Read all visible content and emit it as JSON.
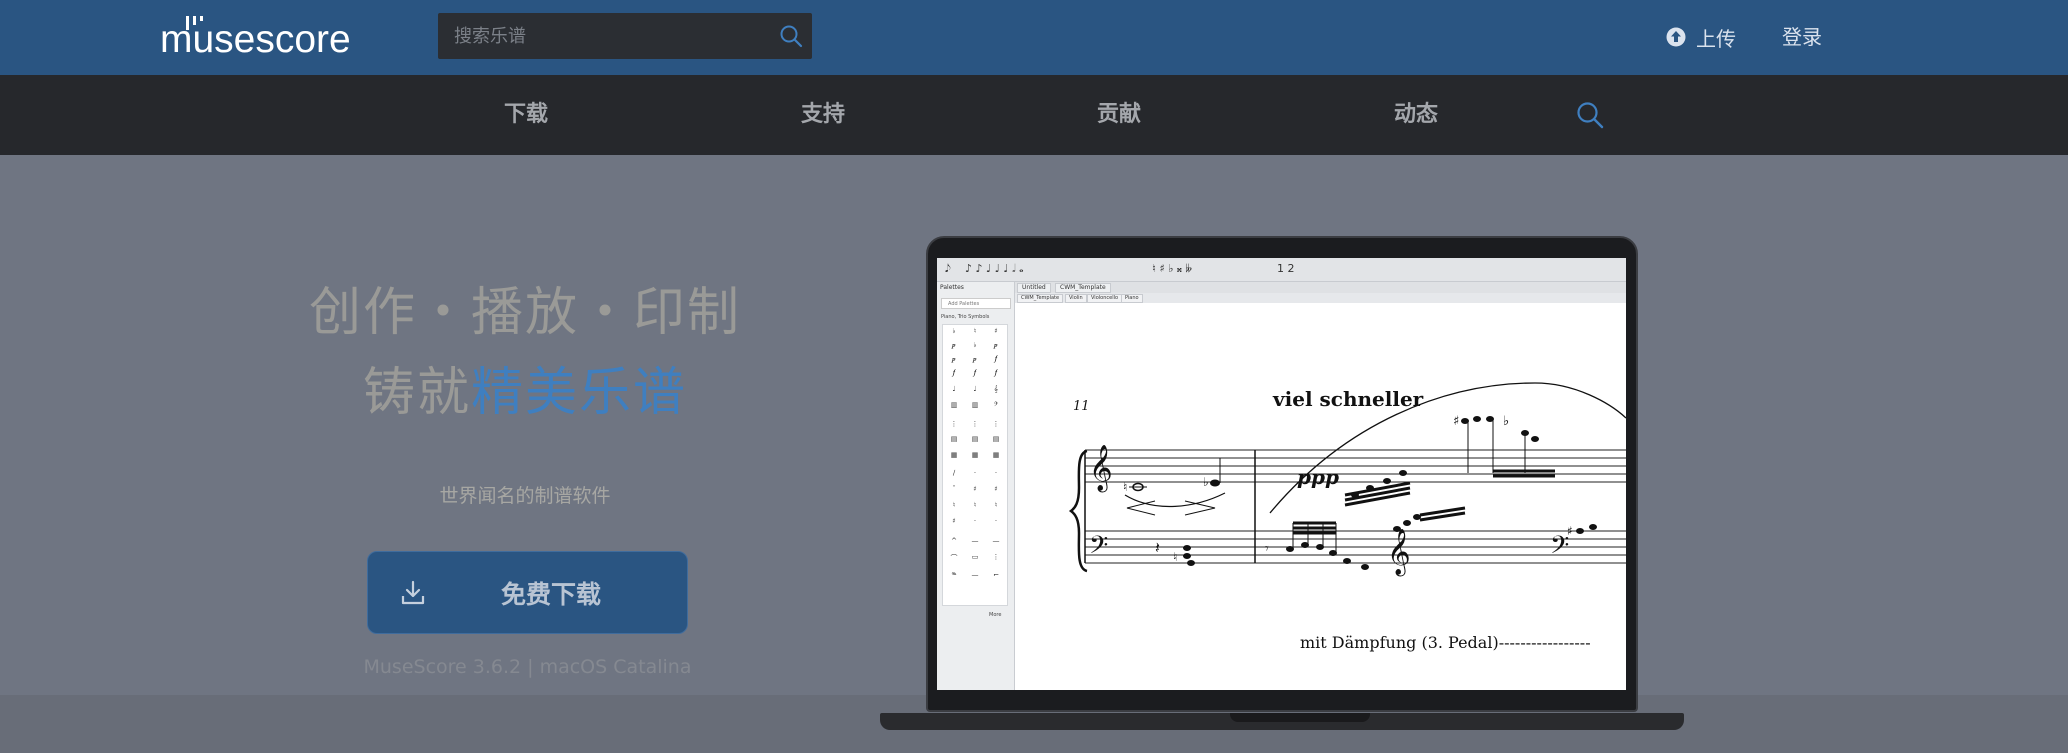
{
  "header": {
    "logo_text": "musescore",
    "search_placeholder": "搜索乐谱",
    "upload_label": "上传",
    "login_label": "登录"
  },
  "nav": {
    "items": [
      "下载",
      "支持",
      "贡献",
      "动态"
    ]
  },
  "hero": {
    "headline_line1": "创作・播放・印制",
    "headline_line2_prefix": "铸就",
    "headline_line2_accent": "精美乐谱",
    "tagline": "世界闻名的制谱软件",
    "download_button": "免费下载",
    "version_info": "MuseScore 3.6.2 | macOS Catalina"
  },
  "app_screenshot": {
    "palette_title": "Palettes",
    "palette_search": "Add Palettes",
    "palette_section": "Piano, Trio Symbols",
    "palette_more": "More",
    "tabs": [
      "Untitled",
      "CWM_Template"
    ],
    "subtabs": [
      "CWM_Template",
      "Violin",
      "Violoncello",
      "Piano"
    ],
    "measure_number": "11",
    "tempo_text": "viel schneller",
    "dynamic": "ppp",
    "pedal_text": "mit Dämpfung (3. Pedal)-----------------"
  },
  "colors": {
    "topbar": "#2a5582",
    "nav": "#26282c",
    "accent": "#3f7fc0",
    "hero_bg": "#6f7582"
  }
}
